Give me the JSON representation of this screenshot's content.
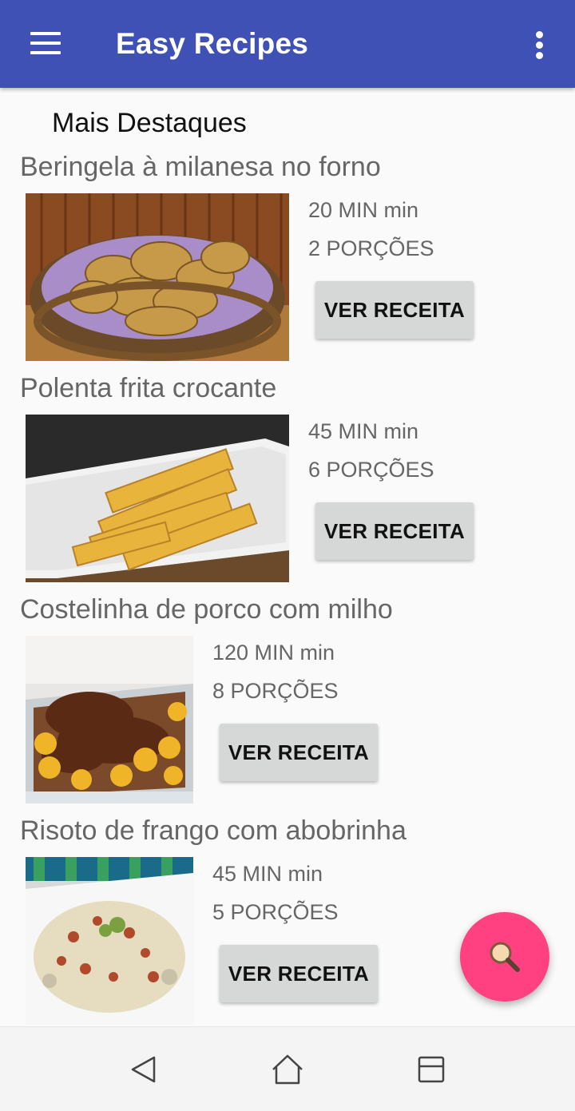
{
  "app": {
    "title": "Easy Recipes",
    "colors": {
      "appbar": "#3f51b5",
      "fab": "#ff4081",
      "button": "#d6d7d7"
    }
  },
  "section_title": "Mais Destaques",
  "recipes": [
    {
      "title": "Beringela à milanesa no forno",
      "time": "20 MIN min",
      "portions": "2 PORÇÕES",
      "button": "VER RECEITA",
      "image": "fried-eggplant-basket"
    },
    {
      "title": "Polenta frita crocante",
      "time": "45 MIN min",
      "portions": "6 PORÇÕES",
      "button": "VER RECEITA",
      "image": "fried-polenta-sticks"
    },
    {
      "title": "Costelinha de porco com milho",
      "time": "120 MIN min",
      "portions": "8 PORÇÕES",
      "button": "VER RECEITA",
      "image": "pork-ribs-with-corn"
    },
    {
      "title": "Risoto de frango com abobrinha",
      "time": "45 MIN min",
      "portions": "5 PORÇÕES",
      "button": "VER RECEITA",
      "image": "chicken-zucchini-risotto"
    }
  ],
  "icons": {
    "menu": "hamburger-menu-icon",
    "more": "more-vertical-icon",
    "fab": "search-icon",
    "nav_back": "back-triangle-icon",
    "nav_home": "home-icon",
    "nav_recents": "recents-icon"
  }
}
